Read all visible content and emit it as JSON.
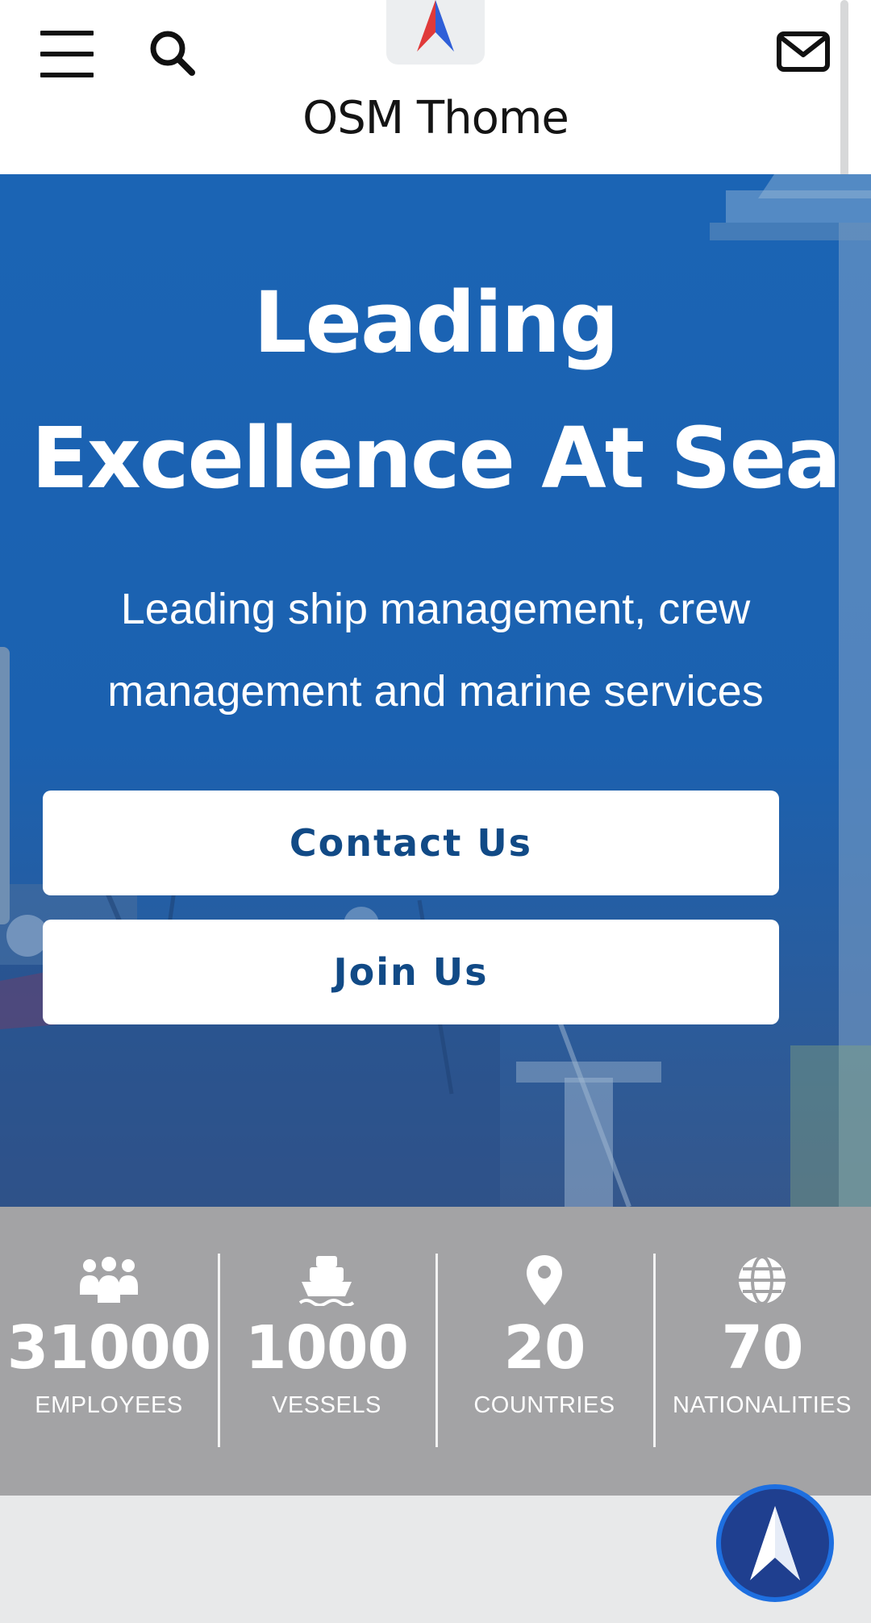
{
  "header": {
    "brand_name": "OSM Thome",
    "menu_icon": "hamburger-menu-icon",
    "search_icon": "search-icon",
    "mail_icon": "mail-icon",
    "logo_icon": "osm-compass-logo"
  },
  "hero": {
    "title_line1": "Leading",
    "title_line2": "Excellence At Sea",
    "subtitle_line1": "Leading ship management, crew",
    "subtitle_line2": "management and marine services",
    "contact_label": "Contact Us",
    "join_label": "Join Us"
  },
  "stats": [
    {
      "icon": "people-icon",
      "value": "31000",
      "label": "EMPLOYEES"
    },
    {
      "icon": "ship-icon",
      "value": "1000",
      "label": "VESSELS"
    },
    {
      "icon": "location-pin-icon",
      "value": "20",
      "label": "COUNTRIES"
    },
    {
      "icon": "globe-icon",
      "value": "70",
      "label": "NATIONALITIES"
    }
  ],
  "colors": {
    "hero_blue": "#1b64b4",
    "button_text": "#114a86",
    "stats_bg": "#a3a3a5",
    "fab_blue": "#1f3f8f",
    "logo_red": "#e03a3a",
    "logo_blue": "#2f5fd8"
  }
}
